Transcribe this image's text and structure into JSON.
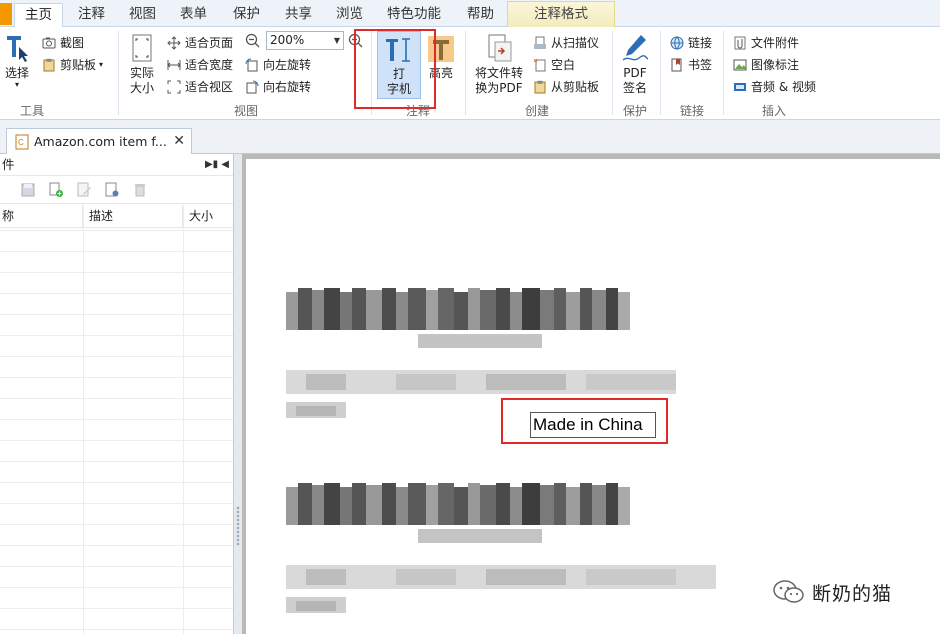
{
  "menu": {
    "items": [
      "主页",
      "注释",
      "视图",
      "表单",
      "保护",
      "共享",
      "浏览",
      "特色功能",
      "帮助"
    ],
    "context_tab": "注释格式"
  },
  "ribbon": {
    "tools": {
      "select_label": "选择",
      "group_label": "工具"
    },
    "clipboard": {
      "screenshot": "截图",
      "clipboard": "剪贴板"
    },
    "view": {
      "actual_size": "实际\n大小",
      "fit_page": "适合页面",
      "fit_width": "适合宽度",
      "fit_view": "适合视区",
      "zoom_value": "200%",
      "rotate_left": "向左旋转",
      "rotate_right": "向右旋转",
      "group_label": "视图"
    },
    "annotate": {
      "typewriter_label": "打\n字机",
      "highlight_label": "高亮",
      "group_label": "注释"
    },
    "create": {
      "convert_label": "将文件转\n换为PDF",
      "from_scanner": "从扫描仪",
      "blank": "空白",
      "from_clipboard": "从剪贴板",
      "group_label": "创建"
    },
    "protect": {
      "sign_label": "PDF\n签名",
      "group_label": "保护"
    },
    "links": {
      "link": "链接",
      "bookmark": "书签",
      "group_label": "链接"
    },
    "insert": {
      "attachment": "文件附件",
      "image_annot": "图像标注",
      "audio_video": "音频 & 视频",
      "group_label": "插入"
    }
  },
  "doc_tab": {
    "title": "Amazon.com item f..."
  },
  "left_panel": {
    "title": "件",
    "columns": [
      "称",
      "描述",
      "大小"
    ]
  },
  "document": {
    "typed_text": "Made in China"
  },
  "watermark": {
    "text": "断奶的猫"
  },
  "colors": {
    "accent_orange": "#f39800",
    "highlight_red": "#e02a2a",
    "selected_blue": "#cfe2f7"
  }
}
